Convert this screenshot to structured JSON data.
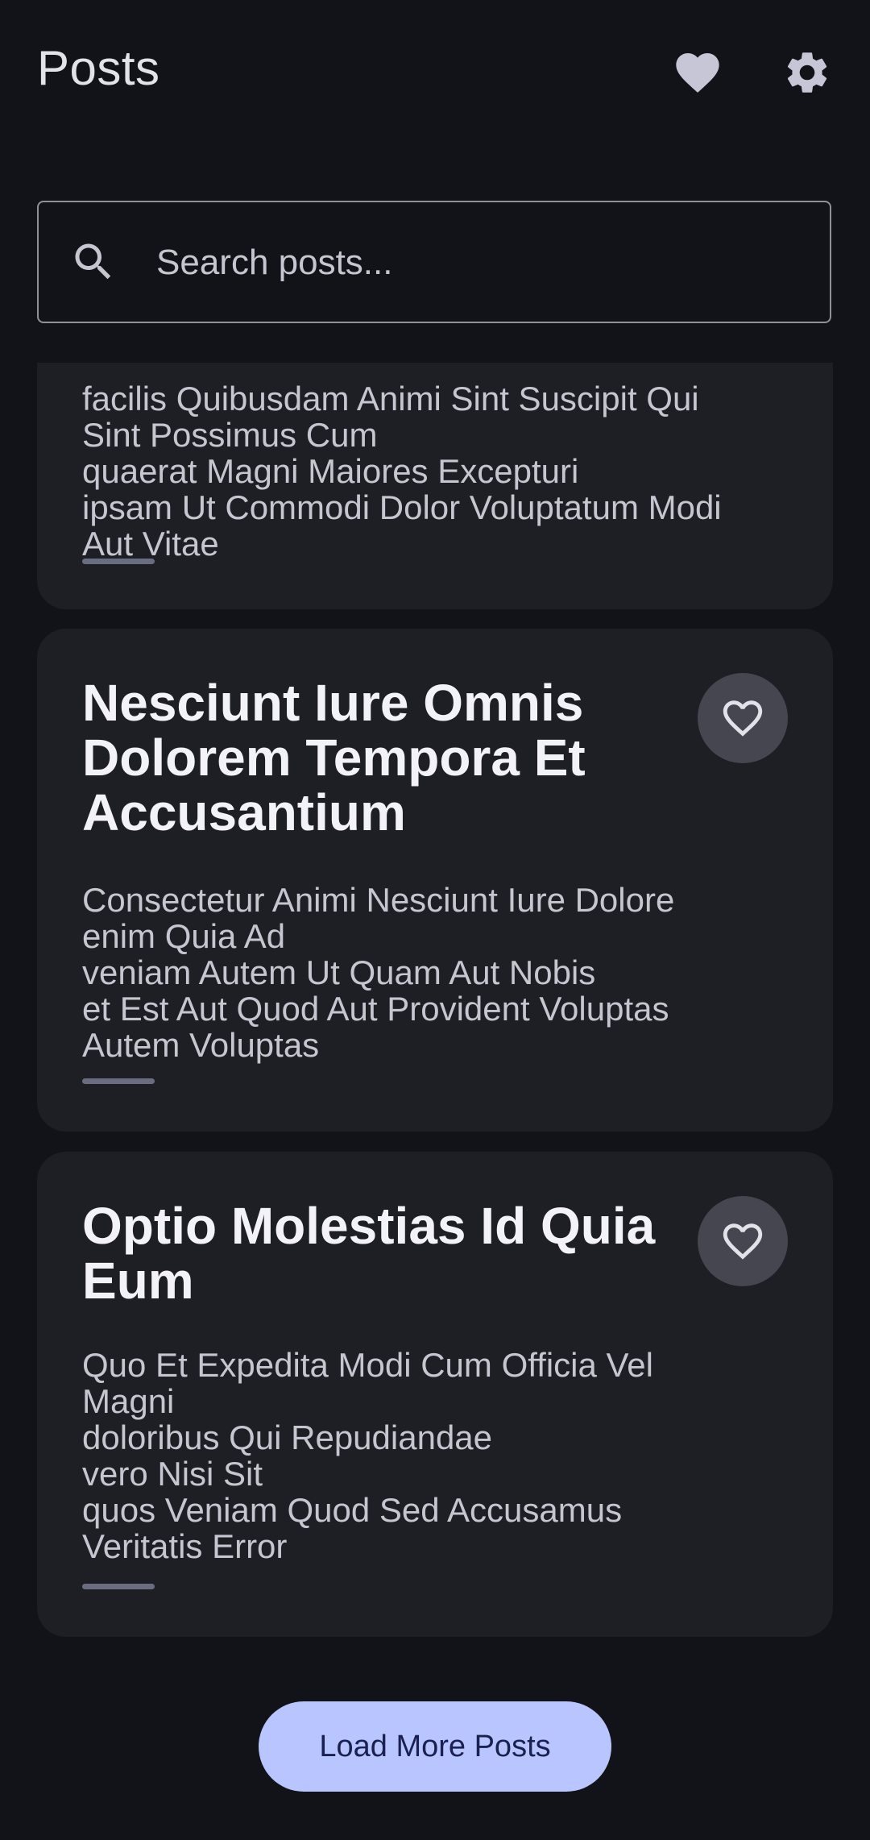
{
  "app_bar": {
    "title": "Posts",
    "favorites_icon": "heart-filled-icon",
    "settings_icon": "gear-icon"
  },
  "search": {
    "placeholder": "Search posts...",
    "value": "",
    "icon": "search-icon"
  },
  "posts": [
    {
      "title": "",
      "body_lines": [
        "facilis Quibusdam Animi Sint Suscipit Qui",
        "Sint Possimus Cum",
        "quaerat Magni Maiores Excepturi",
        "ipsam Ut Commodi Dolor Voluptatum Modi",
        "Aut Vitae"
      ],
      "favorite_icon": "heart-outline-icon"
    },
    {
      "title": "Nesciunt Iure Omnis Dolorem Tempora Et Accusantium",
      "body_lines": [
        "Consectetur Animi Nesciunt Iure Dolore",
        "enim Quia Ad",
        "veniam Autem Ut Quam Aut Nobis",
        "et Est Aut Quod Aut Provident Voluptas",
        "Autem Voluptas"
      ],
      "favorite_icon": "heart-outline-icon"
    },
    {
      "title": "Optio Molestias Id Quia Eum",
      "body_lines": [
        "Quo Et Expedita Modi Cum Officia Vel",
        "Magni",
        "doloribus Qui Repudiandae",
        "vero Nisi Sit",
        "quos Veniam Quod Sed Accusamus",
        "Veritatis Error"
      ],
      "favorite_icon": "heart-outline-icon"
    }
  ],
  "load_more": {
    "label": "Load More Posts"
  },
  "colors": {
    "background": "#121318",
    "card": "#1e1f25",
    "accent": "#b8c5ff",
    "heart_button_bg": "#45464f"
  }
}
